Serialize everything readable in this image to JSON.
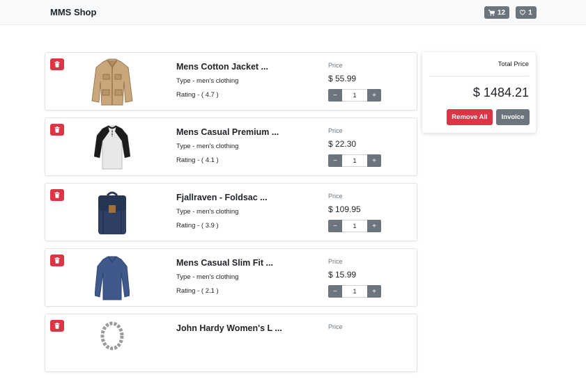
{
  "navbar": {
    "brand": "MMS Shop",
    "cart_count": "12",
    "wishlist_count": "1"
  },
  "items": [
    {
      "name": "Mens Cotton Jacket ...",
      "type": "Type - men's clothing",
      "rating": "Rating - ( 4.7 )",
      "price_label": "Price",
      "price": "$ 55.99",
      "qty": "1",
      "image": "cotton-jacket",
      "minus": "−",
      "plus": "+"
    },
    {
      "name": "Mens Casual Premium ...",
      "type": "Type - men's clothing",
      "rating": "Rating - ( 4.1 )",
      "price_label": "Price",
      "price": "$ 22.30",
      "qty": "1",
      "image": "raglan-tshirt",
      "minus": "−",
      "plus": "+"
    },
    {
      "name": "Fjallraven - Foldsac ...",
      "type": "Type - men's clothing",
      "rating": "Rating - ( 3.9 )",
      "price_label": "Price",
      "price": "$ 109.95",
      "qty": "1",
      "image": "backpack",
      "minus": "−",
      "plus": "+"
    },
    {
      "name": "Mens Casual Slim Fit ...",
      "type": "Type - men's clothing",
      "rating": "Rating - ( 2.1 )",
      "price_label": "Price",
      "price": "$ 15.99",
      "qty": "1",
      "image": "slim-tshirt",
      "minus": "−",
      "plus": "+"
    },
    {
      "name": "John Hardy Women's L ...",
      "price_label": "Price",
      "image": "chain-bracelet"
    }
  ],
  "summary": {
    "total_label": "Total Price",
    "total_value": "$ 1484.21",
    "remove_all_label": "Remove All",
    "invoice_label": "Invoice"
  },
  "colors": {
    "danger": "#dc3545",
    "secondary": "#6c757d",
    "navbar_bg": "#f8f9fa"
  }
}
